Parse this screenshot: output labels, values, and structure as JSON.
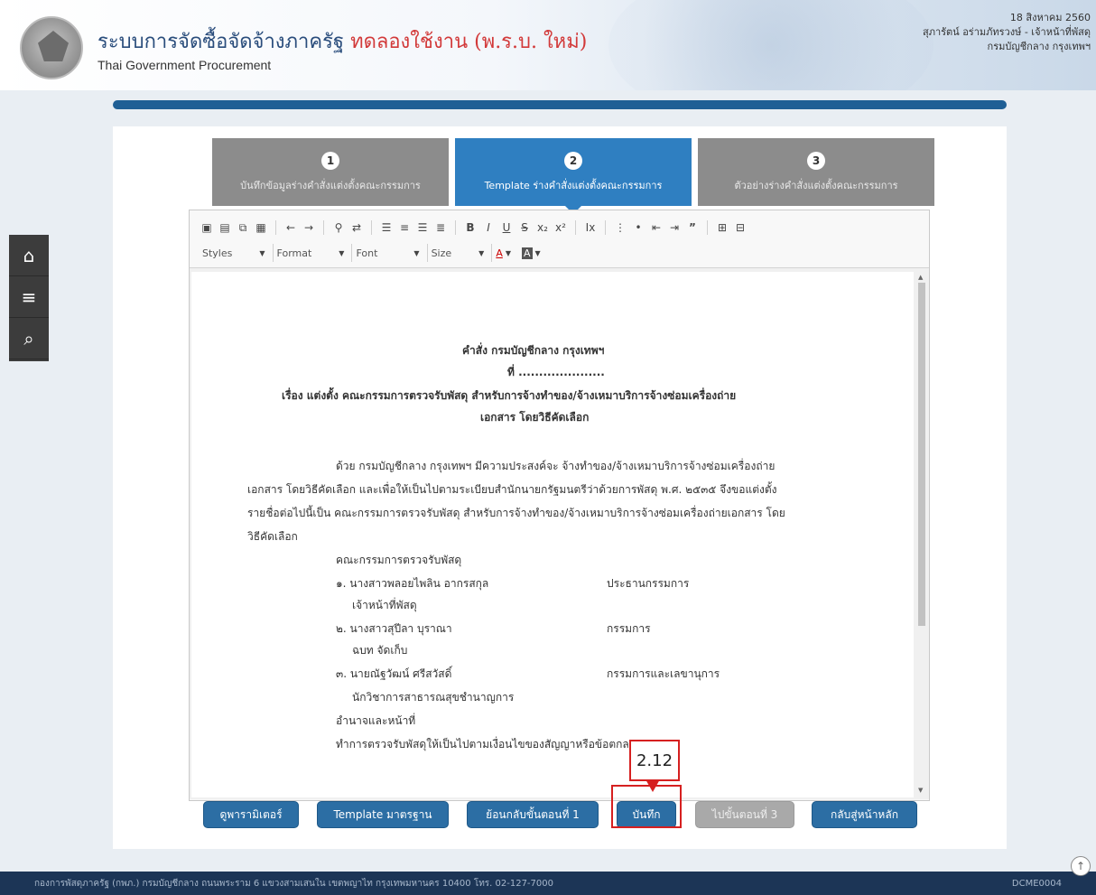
{
  "header": {
    "title_th": "ระบบการจัดซื้อจัดจ้างภาครัฐ",
    "title_trial": "ทดลองใช้งาน (พ.ร.บ. ใหม่)",
    "title_en": "Thai Government Procurement",
    "date": "18 สิงหาคม 2560",
    "user": "สุภารัตน์ อร่ามภัทรวงษ์ - เจ้าหน้าที่พัสดุ",
    "dept": "กรมบัญชีกลาง กรุงเทพฯ"
  },
  "side_nav": [
    "home-icon",
    "menu-icon",
    "search-icon"
  ],
  "steps": [
    {
      "num": "1",
      "label": "บันทึกข้อมูลร่างคำสั่งแต่งตั้งคณะกรรมการ"
    },
    {
      "num": "2",
      "label": "Template ร่างคำสั่งแต่งตั้งคณะกรรมการ"
    },
    {
      "num": "3",
      "label": "ตัวอย่างร่างคำสั่งแต่งตั้งคณะกรรมการ"
    }
  ],
  "toolbar": {
    "styles": "Styles",
    "format": "Format",
    "font": "Font",
    "size": "Size"
  },
  "document": {
    "heading": "คำสั่ง กรมบัญชีกลาง กรุงเทพฯ",
    "number": "ที่ .....................",
    "subject": "เรื่อง แต่งตั้ง คณะกรรมการตรวจรับพัสดุ สำหรับการจ้างทำของ/จ้างเหมาบริการจ้างซ่อมเครื่องถ่าย",
    "subject2": "เอกสาร โดยวิธีคัดเลือก",
    "para1": "ด้วย กรมบัญชีกลาง กรุงเทพฯ มีความประสงค์จะ จ้างทำของ/จ้างเหมาบริการจ้างซ่อมเครื่องถ่าย",
    "para2": "เอกสาร โดยวิธีคัดเลือก และเพื่อให้เป็นไปตามระเบียบสำนักนายกรัฐมนตรีว่าด้วยการพัสดุ พ.ศ. ๒๕๓๕ จึงขอแต่งตั้ง",
    "para3": "รายชื่อต่อไปนี้เป็น คณะกรรมการตรวจรับพัสดุ สำหรับการจ้างทำของ/จ้างเหมาบริการจ้างซ่อมเครื่องถ่ายเอกสาร โดย",
    "para4": "วิธีคัดเลือก",
    "committee_title": "คณะกรรมการตรวจรับพัสดุ",
    "m1_name": "๑. นางสาวพลอยไพลิน อากรสกุล",
    "m1_role": "ประธานกรรมการ",
    "m1_pos": "เจ้าหน้าที่พัสดุ",
    "m2_name": "๒. นางสาวสุปีลา บุราณา",
    "m2_role": "กรรมการ",
    "m2_pos": "ฉบท จัดเก็บ",
    "m3_name": "๓. นายณัฐวัฒน์ ศรีสวัสดิ์",
    "m3_role": "กรรมการและเลขานุการ",
    "m3_pos": "นักวิชาการสาธารณสุขชำนาญการ",
    "duty_title": "อำนาจและหน้าที่",
    "duty": "ทำการตรวจรับพัสดุให้เป็นไปตามเงื่อนไขของสัญญาหรือข้อตกลง"
  },
  "buttons": {
    "parameter": "ดูพารามิเตอร์",
    "template": "Template มาตรฐาน",
    "back": "ย้อนกลับขั้นตอนที่ 1",
    "save": "บันทึก",
    "next": "ไปขั้นตอนที่ 3",
    "home": "กลับสู่หน้าหลัก"
  },
  "annotation": "2.12",
  "footer": {
    "address": "กองการพัสดุภาครัฐ (กพภ.) กรมบัญชีกลาง ถนนพระราม 6 แขวงสามเสนใน เขตพญาไท กรุงเทพมหานคร 10400 โทร. 02-127-7000",
    "code": "DCME0004"
  }
}
